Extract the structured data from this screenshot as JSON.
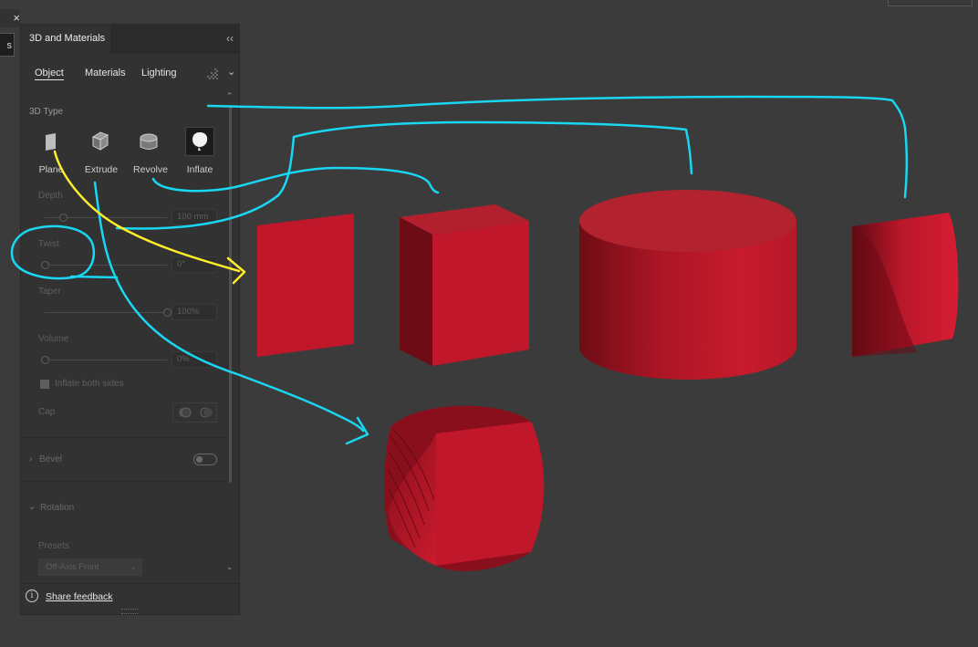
{
  "window": {
    "close_glyph": "×",
    "left_tab_char": "s"
  },
  "panel": {
    "title": "3D and Materials",
    "collapse_glyph": "‹‹",
    "tabs": [
      {
        "label": "Object",
        "active": true
      },
      {
        "label": "Materials",
        "active": false
      },
      {
        "label": "Lighting",
        "active": false
      }
    ],
    "tab_chevron": "⌄",
    "render_icon": "render-grid-icon"
  },
  "type_section": {
    "label": "3D Type",
    "options": [
      {
        "label": "Plane",
        "icon": "plane-icon",
        "selected": false
      },
      {
        "label": "Extrude",
        "icon": "extrude-cube-icon",
        "selected": false
      },
      {
        "label": "Revolve",
        "icon": "revolve-cylinder-icon",
        "selected": false
      },
      {
        "label": "Inflate",
        "icon": "inflate-balloon-icon",
        "selected": true
      }
    ]
  },
  "properties": {
    "depth": {
      "label": "Depth",
      "value": "100 mm",
      "level": 0.15
    },
    "twist": {
      "label": "Twist",
      "value": "0°",
      "level": 0.0
    },
    "taper": {
      "label": "Taper",
      "value": "100%",
      "level": 1.0
    },
    "volume": {
      "label": "Volume",
      "value": "0%",
      "level": 0.0
    },
    "inflate_both_sides": {
      "label": "Inflate both sides",
      "checked": false
    },
    "cap": {
      "label": "Cap"
    }
  },
  "bevel": {
    "label": "Bevel",
    "chevron": "›",
    "enabled": false
  },
  "rotation": {
    "label": "Rotation",
    "chevron": "⌄",
    "presets_label": "Presets",
    "preset_value": "Off-Axis Front",
    "preset_chevron": "⌄"
  },
  "scroll": {
    "up": "⌃",
    "down": "⌄"
  },
  "footer": {
    "info_glyph": "i",
    "feedback_label": "Share feedback"
  },
  "colors": {
    "canvas_bg": "#3b3b3b",
    "panel_bg": "#323232",
    "shape_red": "#c0182a",
    "annotation_cyan": "#19d7f2",
    "annotation_yellow": "#ffee2a"
  }
}
